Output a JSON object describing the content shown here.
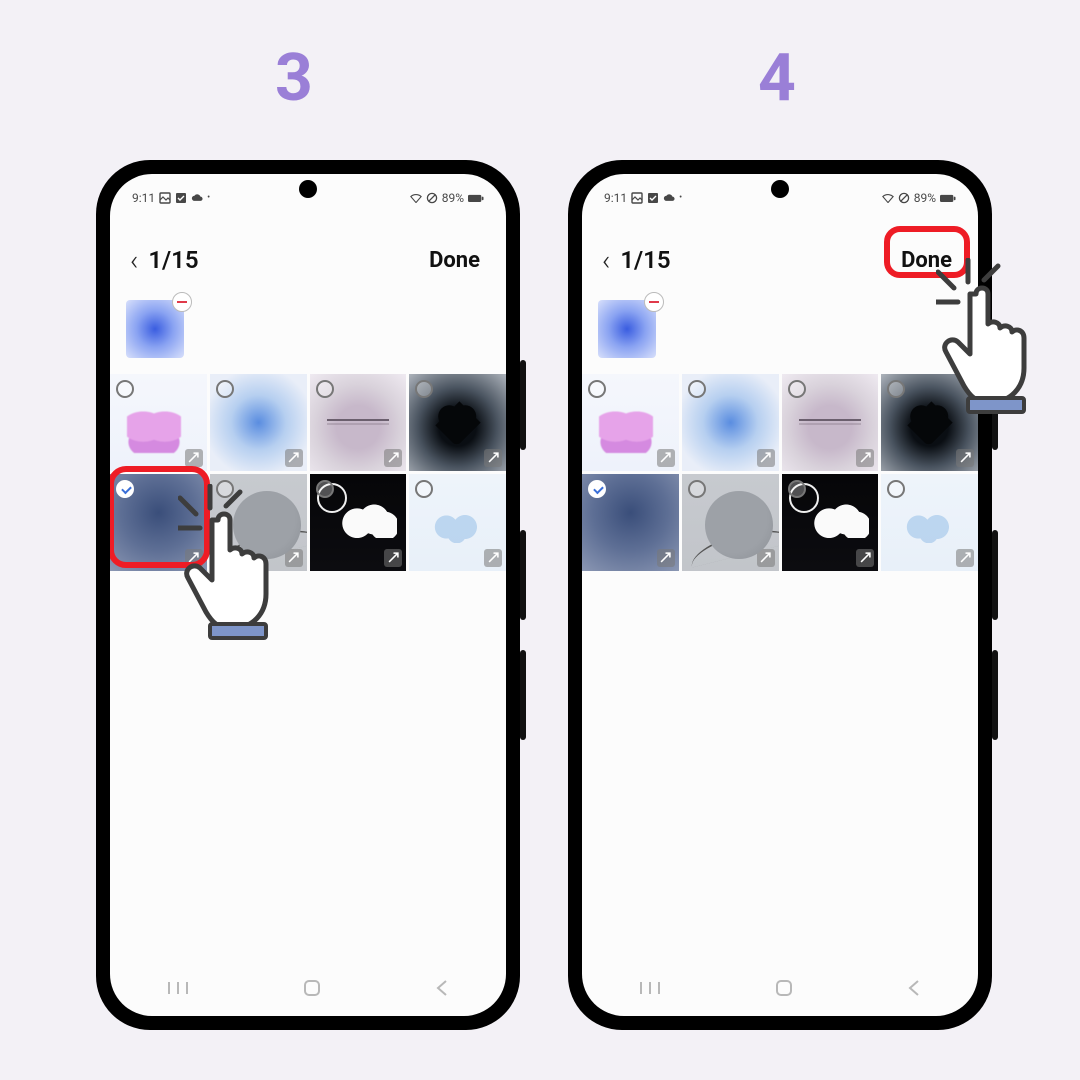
{
  "steps": {
    "left": "3",
    "right": "4"
  },
  "status": {
    "time": "9:11",
    "battery_text": "89%"
  },
  "header": {
    "counter": "1/15",
    "done_label": "Done"
  },
  "selected_strip": [
    {
      "id": "sel-blue-gradient"
    }
  ],
  "grid_tiles": [
    {
      "name": "butterfly",
      "checked": false
    },
    {
      "name": "blue-heart",
      "checked": false
    },
    {
      "name": "text-heart",
      "checked": false
    },
    {
      "name": "dark-heart",
      "checked": false
    },
    {
      "name": "navy-gradient",
      "checked": true
    },
    {
      "name": "planet",
      "checked": false
    },
    {
      "name": "night-clouds",
      "checked": false
    },
    {
      "name": "sky-clouds",
      "checked": false
    }
  ],
  "annotation": {
    "left_highlight": "grid-tile-navy-gradient",
    "right_highlight": "done-button"
  }
}
